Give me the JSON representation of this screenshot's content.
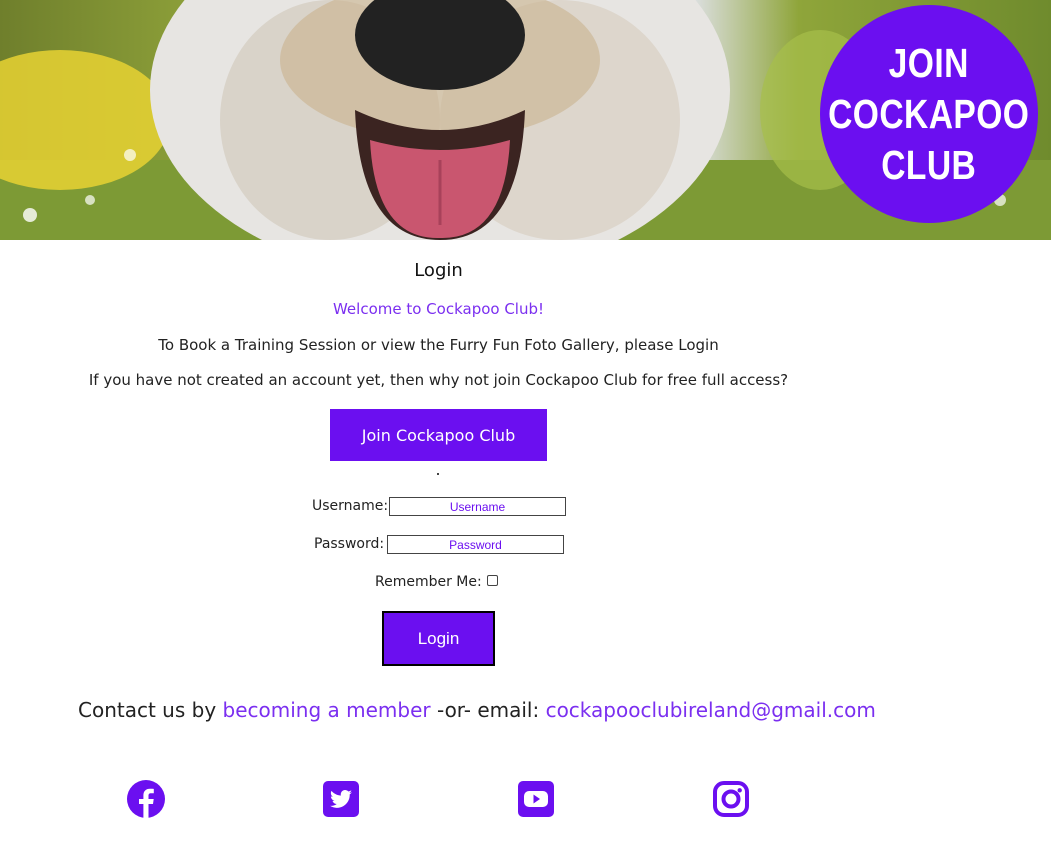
{
  "hero": {
    "badge_line1": "JOIN",
    "badge_line2": "COCKAPOO",
    "badge_line3": "CLUB"
  },
  "login": {
    "title": "Login",
    "welcome": "Welcome to Cockapoo Club!",
    "instruction": "To Book a Training Session or view the Furry Fun Foto Gallery, please Login",
    "join_prompt": "If you have not created an account yet, then why not join Cockapoo Club for free full access?",
    "join_button": "Join Cockapoo Club",
    "username_label": "Username:",
    "username_placeholder": "Username",
    "password_label": "Password:",
    "password_placeholder": "Password",
    "remember_label": "Remember Me:",
    "submit_button": "Login"
  },
  "footer": {
    "contact_prefix": "Contact us by ",
    "member_link": "becoming a member",
    "contact_middle": " -or- email: ",
    "email": "cockapooclubireland@gmail.com",
    "social": [
      "facebook-icon",
      "twitter-icon",
      "youtube-icon",
      "instagram-icon"
    ]
  },
  "colors": {
    "accent": "#6b0ff0",
    "link": "#7b2ff0"
  }
}
